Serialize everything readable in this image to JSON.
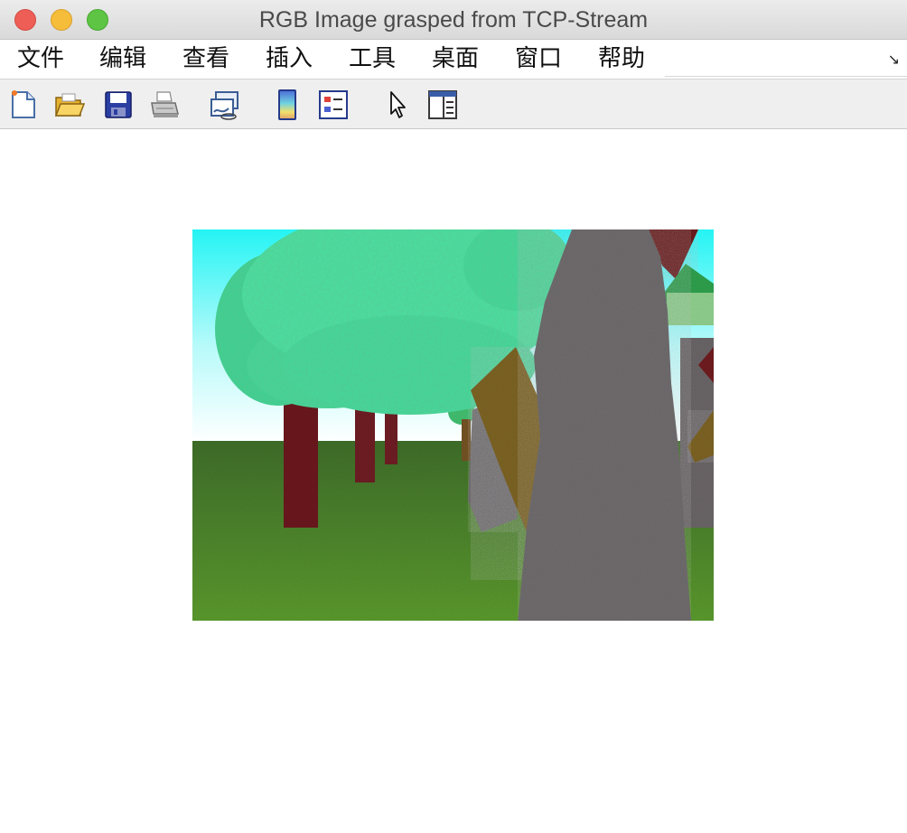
{
  "window": {
    "title": "RGB Image grasped from TCP-Stream"
  },
  "menu": {
    "items": [
      "文件",
      "编辑",
      "查看",
      "插入",
      "工具",
      "桌面",
      "窗口",
      "帮助"
    ],
    "overflow_icon": "dock-arrow-icon"
  },
  "toolbar": {
    "buttons": [
      {
        "icon": "new-figure-icon"
      },
      {
        "icon": "open-file-icon"
      },
      {
        "icon": "save-icon"
      },
      {
        "icon": "print-icon"
      },
      {
        "icon": "link-plot-icon"
      },
      {
        "icon": "colorbar-icon"
      },
      {
        "icon": "legend-icon"
      },
      {
        "icon": "edit-plot-arrow-icon"
      },
      {
        "icon": "property-inspector-icon"
      }
    ]
  },
  "image": {
    "description_colors": {
      "sky": "#2ff4f4",
      "ground": "#4f8a2a",
      "foliage": "#3fd98f",
      "trunk_red": "#6b1a1e",
      "trunk_gray": "#6f6a6c",
      "trunk_brown": "#7d6322"
    }
  }
}
